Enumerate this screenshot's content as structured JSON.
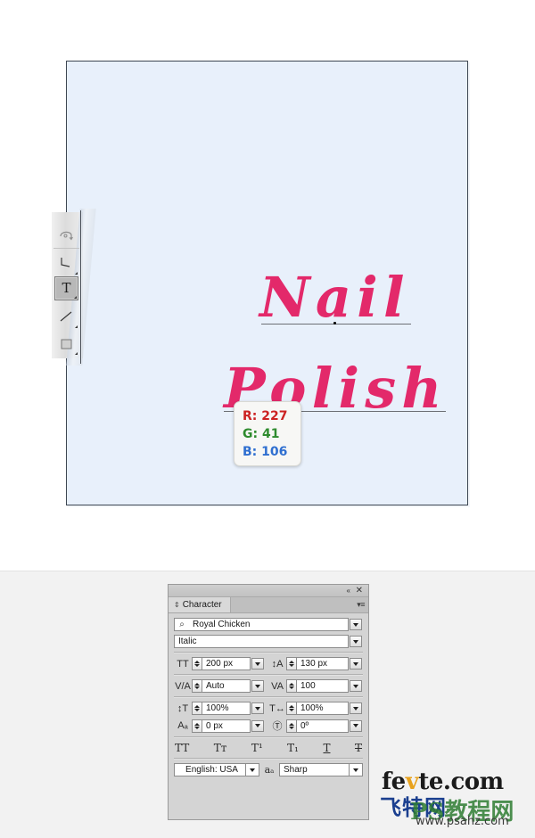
{
  "artwork": {
    "line1": "Nail",
    "line2": "Polish",
    "text_color": "#E3296A",
    "canvas_background": "#E8F0FB",
    "canvas_border": "#3D4652"
  },
  "toolbar": {
    "tools": [
      {
        "name": "rotate-tool",
        "selected": false
      },
      {
        "name": "pen-tool",
        "selected": false
      },
      {
        "name": "type-tool",
        "label": "T",
        "selected": true
      },
      {
        "name": "line-segment-tool",
        "selected": false
      },
      {
        "name": "rectangle-tool",
        "selected": false
      }
    ]
  },
  "color_readout": {
    "r_label": "R: 227",
    "g_label": "G: 41",
    "b_label": "B: 106",
    "r_color": "#CC2222",
    "g_color": "#2E8B2E",
    "b_color": "#2F6FD0"
  },
  "character_panel": {
    "title_tab": "Character",
    "collapse_icon": "«",
    "close_icon": "✕",
    "menu_icon": "▾≡",
    "tab_anchor_icon": "⇕",
    "font_family": {
      "value": "Royal Chicken",
      "search_icon": "⌕"
    },
    "font_style": {
      "value": "Italic"
    },
    "font_size": {
      "icon": "TT",
      "value": "200 px"
    },
    "leading": {
      "icon": "↕A",
      "value": "130 px"
    },
    "kerning": {
      "icon": "V/A",
      "value": "Auto"
    },
    "tracking": {
      "icon": "VA",
      "value": "100"
    },
    "vertical_scale": {
      "icon": "↕T",
      "value": "100%"
    },
    "horizontal_scale": {
      "icon": "T↔",
      "value": "100%"
    },
    "baseline_shift": {
      "icon": "Aₐ",
      "value": "0 px"
    },
    "character_rotation": {
      "icon": "Ⓣ",
      "value": "0º"
    },
    "style_buttons": [
      {
        "name": "all-caps-button",
        "label": "TT"
      },
      {
        "name": "small-caps-button",
        "label": "Tᴛ"
      },
      {
        "name": "superscript-button",
        "label": "T¹"
      },
      {
        "name": "subscript-button",
        "label": "T₁"
      },
      {
        "name": "underline-button",
        "label": "T"
      },
      {
        "name": "strikethrough-button",
        "label": "T"
      }
    ],
    "language": {
      "value": "English: USA"
    },
    "anti_aliasing": {
      "icon": "aₐ",
      "value": "Sharp"
    }
  },
  "watermark": {
    "site": "fevte.com",
    "site_prefix": "fe",
    "site_accent": "v",
    "site_suffix": "te.com",
    "chinese": "飞特网",
    "overlay": "PS教程网",
    "url": "www.psahz.com"
  }
}
